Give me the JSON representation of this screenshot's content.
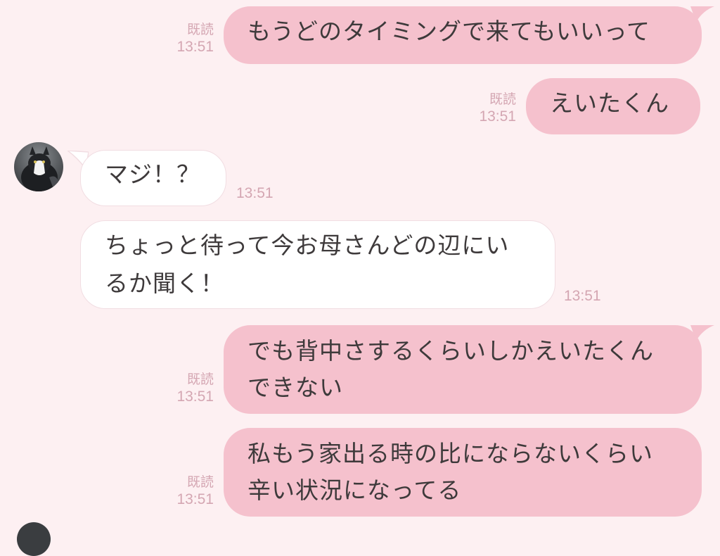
{
  "messages": [
    {
      "side": "out",
      "read": "既読",
      "time": "13:51",
      "text": "もうどのタイミングで来てもいいって"
    },
    {
      "side": "out",
      "read": "既読",
      "time": "13:51",
      "text": "えいたくん"
    },
    {
      "side": "in",
      "time": "13:51",
      "text": "マジ！？"
    },
    {
      "side": "in",
      "time": "13:51",
      "text": "ちょっと待って今お母さんどの辺にい\nるか聞く！"
    },
    {
      "side": "out",
      "read": "既読",
      "time": "13:51",
      "text": "でも背中さするくらいしかえいたくん\nできない"
    },
    {
      "side": "out",
      "read": "既読",
      "time": "13:51",
      "text": "私もう家出る時の比にならないくらい\n辛い状況になってる"
    }
  ],
  "contact": {
    "avatar_icon": "cat-avatar-icon"
  },
  "colors": {
    "background": "#fdf0f2",
    "outgoing_bubble": "#f5c1cd",
    "incoming_bubble": "#ffffff",
    "meta_text": "#d4a6b2",
    "message_text": "#3e3a3b"
  }
}
